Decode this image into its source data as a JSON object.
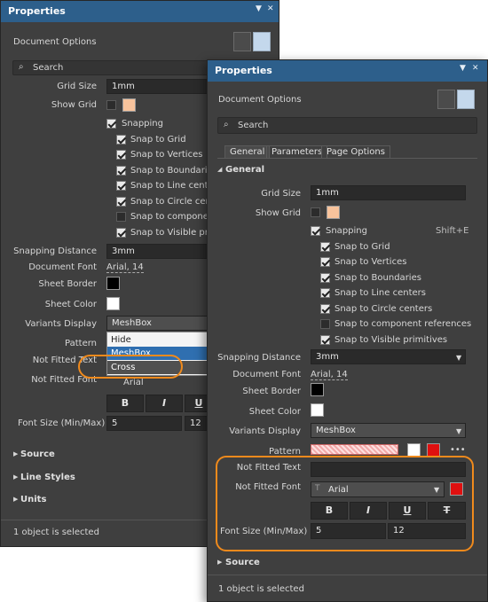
{
  "back": {
    "title": "Properties",
    "doc_options": "Document Options",
    "search_placeholder": "Search",
    "grid_size_label": "Grid Size",
    "grid_size_value": "1mm",
    "show_grid_label": "Show Grid",
    "snapping_label": "Snapping",
    "snap_items": [
      "Snap to Grid",
      "Snap to Vertices",
      "Snap to Boundaries",
      "Snap to Line center",
      "Snap to Circle cent",
      "Snap to componen",
      "Snap to Visible prim"
    ],
    "snapping_distance_label": "Snapping Distance",
    "snapping_distance_value": "3mm",
    "document_font_label": "Document Font",
    "document_font_value": "Arial, 14",
    "sheet_border_label": "Sheet Border",
    "sheet_color_label": "Sheet Color",
    "variants_display_label": "Variants Display",
    "variants_display_value": "MeshBox",
    "pattern_label": "Pattern",
    "not_fitted_text_label": "Not Fitted Text",
    "not_fitted_font_label": "Not Fitted Font",
    "font_value": "Arial",
    "dropdown_options": [
      "Hide",
      "MeshBox",
      "Cross"
    ],
    "font_size_label": "Font Size (Min/Max)",
    "font_min": "5",
    "font_max": "12",
    "bold": "B",
    "italic": "I",
    "underline": "U",
    "sections": [
      "Source",
      "Line Styles",
      "Units"
    ],
    "status": "1 object is selected"
  },
  "front": {
    "title": "Properties",
    "doc_options": "Document Options",
    "search_placeholder": "Search",
    "tabs": [
      "General",
      "Parameters",
      "Page Options"
    ],
    "general_section": "General",
    "grid_size_label": "Grid Size",
    "grid_size_value": "1mm",
    "show_grid_label": "Show Grid",
    "snapping_label": "Snapping",
    "snapping_shortcut": "Shift+E",
    "snap_items": [
      "Snap to Grid",
      "Snap to Vertices",
      "Snap to Boundaries",
      "Snap to Line centers",
      "Snap to Circle centers",
      "Snap to component references",
      "Snap to Visible primitives"
    ],
    "snapping_distance_label": "Snapping Distance",
    "snapping_distance_value": "3mm",
    "document_font_label": "Document Font",
    "document_font_value": "Arial, 14",
    "sheet_border_label": "Sheet Border",
    "sheet_color_label": "Sheet Color",
    "variants_display_label": "Variants Display",
    "variants_display_value": "MeshBox",
    "pattern_label": "Pattern",
    "more": "•••",
    "not_fitted_text_label": "Not Fitted Text",
    "not_fitted_font_label": "Not Fitted Font",
    "font_value": "Arial",
    "bold": "B",
    "italic": "I",
    "underline": "U",
    "strike": "T",
    "font_size_label": "Font Size (Min/Max)",
    "font_min": "5",
    "font_max": "12",
    "source_section": "Source",
    "status": "1 object is selected"
  },
  "colors": {
    "title_bar": "#2d5f8b",
    "panel": "#3f3f3f",
    "highlight": "#f08a1c",
    "swatch_peach": "#f8c39c",
    "red": "#e01010"
  }
}
